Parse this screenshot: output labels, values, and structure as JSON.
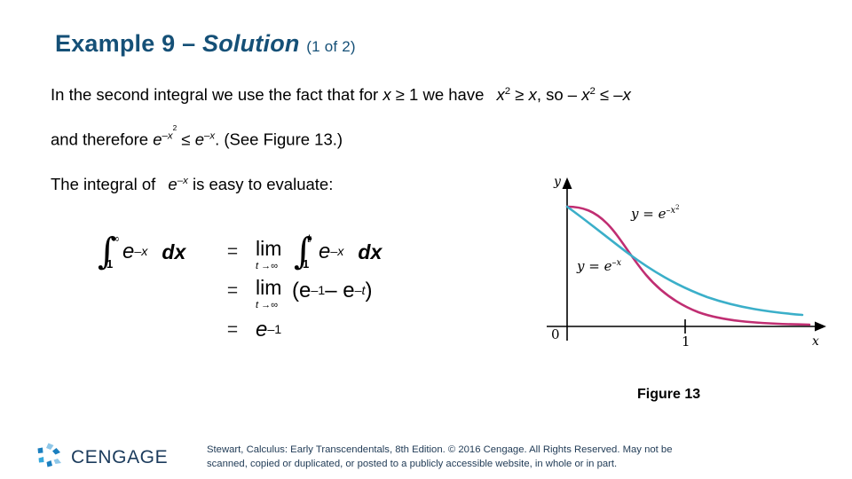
{
  "slide": {
    "title_main": "Example 9 –",
    "title_italic": "Solution",
    "title_sub": "(1 of 2)"
  },
  "body": {
    "line1": {
      "text_a": "In the second integral we use the fact that for ",
      "var_x": "x",
      "rel_ge": " ≥ 1 we have ",
      "expr_x2": "x",
      "sup_2": "2",
      "rel_ge2": " ≥ ",
      "var_x2": "x",
      "comma_so": ", so – ",
      "expr_x3": "x",
      "sup_2b": "2",
      "rel_le": " ≤ –",
      "var_x3": "x"
    },
    "line2": {
      "text_a": "and therefore ",
      "e1": "e",
      "e1_sup": "–x",
      "e1_sup2": "2",
      "rel": " ≤ ",
      "e2": "e",
      "e2_sup": "–x",
      "text_b": ". (See Figure 13.)"
    },
    "line3": {
      "text_a": "The integral of ",
      "e1": "e",
      "e1_sup": "–x",
      "text_b": " is easy to evaluate:"
    }
  },
  "equation": {
    "rows": [
      {
        "lhs_integral_upper": "∞",
        "lhs_integral_lower": "1",
        "lhs_fn": "e",
        "lhs_fn_sup": "–x",
        "lhs_dx": "dx",
        "eq": "=",
        "rhs_lim": "lim",
        "rhs_lim_under": "t →∞",
        "rhs_integral_upper": "t",
        "rhs_integral_lower": "1",
        "rhs_fn": "e",
        "rhs_fn_sup": "–x",
        "rhs_dx": "dx"
      },
      {
        "eq": "=",
        "rhs_lim": "lim",
        "rhs_lim_under": "t →∞",
        "rhs_open": "(e",
        "rhs_sup1": "–1",
        "rhs_minus": " – e",
        "rhs_sup2": "–t",
        "rhs_close": " )"
      },
      {
        "eq": "=",
        "rhs_fn": "e",
        "rhs_sup": "–1"
      }
    ]
  },
  "figure": {
    "caption": "Figure 13",
    "axis_y_label": "y",
    "axis_x_label": "x",
    "origin_label": "0",
    "tick_label": "1",
    "curve1_label_y": "y",
    "curve1_label_eq": "= e",
    "curve1_label_sup": "–x",
    "curve1_label_sup2": "2",
    "curve2_label_y": "y",
    "curve2_label_eq": "= e",
    "curve2_label_sup": "–x",
    "colors": {
      "curve_gaussian": "#C02E72",
      "curve_exponential": "#3BAFC9",
      "axis": "#000000"
    }
  },
  "footer": {
    "logo_text": "CENGAGE",
    "copyright_line1": "Stewart, Calculus: Early Transcendentals, 8th Edition. © 2016 Cengage. All Rights Reserved. May not be",
    "copyright_line2": "scanned, copied or duplicated, or posted to a publicly accessible website, in whole or in part."
  },
  "chart_data": {
    "type": "line",
    "title": "Figure 13",
    "xlabel": "x",
    "ylabel": "y",
    "xlim": [
      0,
      3.2
    ],
    "ylim": [
      0,
      1.15
    ],
    "xticks": [
      0,
      1
    ],
    "xticklabels": [
      "0",
      "1"
    ],
    "grid": false,
    "legend": "inline-annotations",
    "series": [
      {
        "name": "y = e^(-x^2)",
        "color": "#C02E72",
        "x": [
          0,
          0.25,
          0.5,
          0.75,
          1.0,
          1.25,
          1.5,
          1.75,
          2.0,
          2.5,
          3.0
        ],
        "y": [
          1.0,
          0.939,
          0.779,
          0.57,
          0.368,
          0.21,
          0.105,
          0.046,
          0.018,
          0.002,
          0.0001
        ]
      },
      {
        "name": "y = e^(-x)",
        "color": "#3BAFC9",
        "x": [
          0,
          0.25,
          0.5,
          0.75,
          1.0,
          1.25,
          1.5,
          1.75,
          2.0,
          2.5,
          3.0
        ],
        "y": [
          1.0,
          0.779,
          0.607,
          0.472,
          0.368,
          0.287,
          0.223,
          0.174,
          0.135,
          0.082,
          0.05
        ]
      }
    ],
    "annotations": [
      {
        "text": "y = e^(-x^2)",
        "x": 0.95,
        "y": 0.92
      },
      {
        "text": "y = e^(-x)",
        "x": 0.18,
        "y": 0.47
      }
    ]
  }
}
